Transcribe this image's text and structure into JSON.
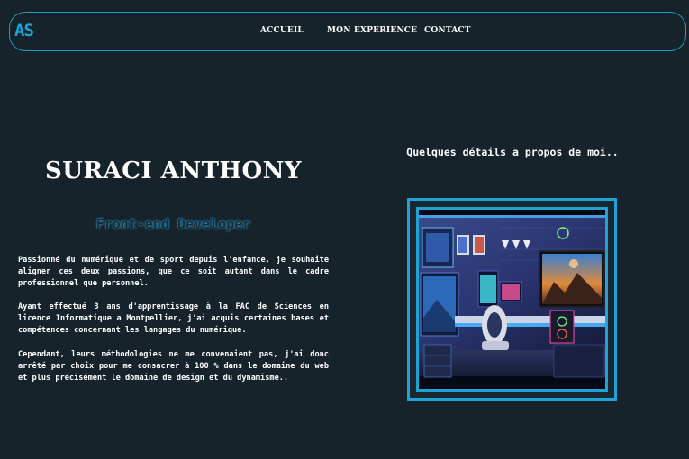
{
  "nav": {
    "logo": "AS",
    "links": [
      "ACCUEIL",
      "MON EXPERIENCE",
      "CONTACT"
    ]
  },
  "profile": {
    "name": "SURACI ANTHONY",
    "role": "Front-end Developer",
    "paragraphs": [
      "Passionné du numérique et de sport depuis l'enfance, je souhaite aligner ces deux passions, que ce soit autant dans le cadre professionnel que personnel.",
      "Ayant effectué 3 ans d'apprentissage à la FAC de Sciences en licence Informatique a Montpellier, j'ai acquis certaines bases et compétences concernant les langages du numérique.",
      "Cependant, leurs méthodologies ne me convenaient pas, j'ai donc arrêté par choix pour me consacrer à 100 % dans le domaine du web et plus précisément le domaine de design et du dynamisme.."
    ]
  },
  "details": {
    "title": "Quelques détails a propos de moi..",
    "image_description": "gaming-desk-setup"
  },
  "colors": {
    "background": "#17232b",
    "accent": "#1fa2d6",
    "text": "#ffffff"
  }
}
